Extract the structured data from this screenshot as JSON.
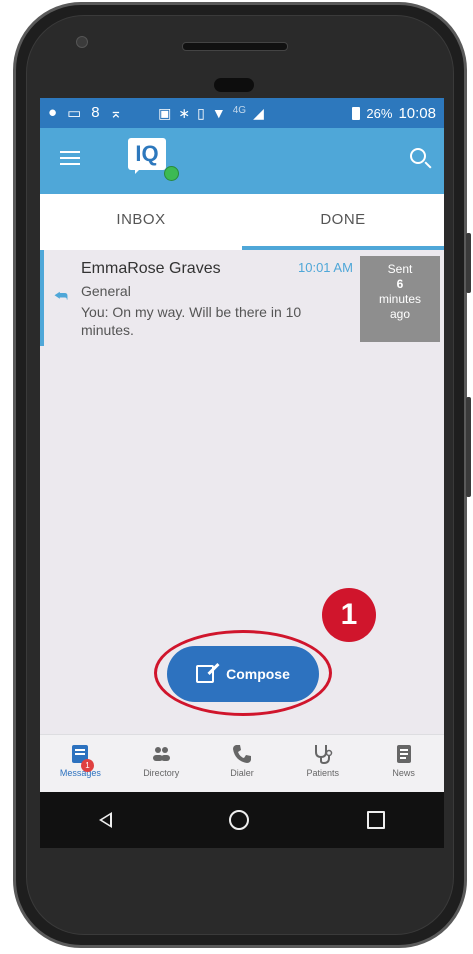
{
  "status_bar": {
    "battery": "26%",
    "time": "10:08",
    "network": "4G"
  },
  "app": {
    "logo_text": "IQ",
    "brand_color": "#4fa7d8",
    "accent": "#2d72bf"
  },
  "tabs": [
    {
      "label": "INBOX",
      "active": false
    },
    {
      "label": "DONE",
      "active": true
    }
  ],
  "message": {
    "name": "EmmaRose Graves",
    "time": "10:01 AM",
    "category": "General",
    "preview": "You: On my way. Will be there in 10 minutes.",
    "sent_label": "Sent",
    "sent_amount": "6",
    "sent_unit": "minutes",
    "sent_suffix": "ago"
  },
  "compose": {
    "label": "Compose"
  },
  "annotation": {
    "step": "1",
    "color": "#d0152c"
  },
  "bottom_nav": [
    {
      "label": "Messages",
      "icon": "messages-icon",
      "badge": "1",
      "active": true
    },
    {
      "label": "Directory",
      "icon": "directory-icon"
    },
    {
      "label": "Dialer",
      "icon": "phone-icon"
    },
    {
      "label": "Patients",
      "icon": "stethoscope-icon"
    },
    {
      "label": "News",
      "icon": "news-icon"
    }
  ]
}
